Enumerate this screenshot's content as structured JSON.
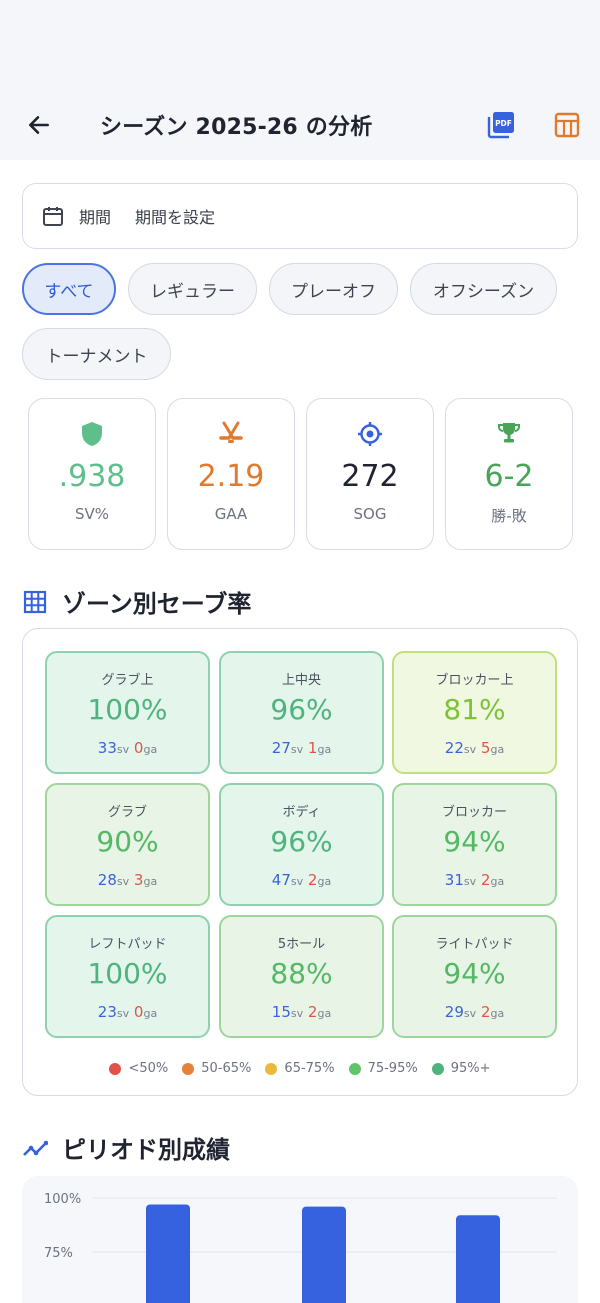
{
  "header": {
    "title": "シーズン 2025-26 の分析",
    "back_icon": "arrow-left-icon",
    "pdf_icon": "pdf-icon",
    "table_icon": "table-icon"
  },
  "period": {
    "label": "期間",
    "value": "期間を設定",
    "icon": "calendar-icon"
  },
  "chips": [
    {
      "label": "すべて",
      "active": true
    },
    {
      "label": "レギュラー",
      "active": false
    },
    {
      "label": "プレーオフ",
      "active": false
    },
    {
      "label": "オフシーズン",
      "active": false
    },
    {
      "label": "トーナメント",
      "active": false
    }
  ],
  "stats": [
    {
      "value": ".938",
      "caption": "SV%",
      "color": "#5fbf8a",
      "icon": "shield-icon"
    },
    {
      "value": "2.19",
      "caption": "GAA",
      "color": "#e07a2f",
      "icon": "crossed-sticks-icon"
    },
    {
      "value": "272",
      "caption": "SOG",
      "color": "#1f2430",
      "icon": "target-icon"
    },
    {
      "value": "6-2",
      "caption": "勝-敗",
      "color": "#4aa457",
      "icon": "trophy-icon"
    }
  ],
  "zones_section": {
    "title": "ゾーン別セーブ率",
    "sv_unit": "sv",
    "ga_unit": "ga",
    "zones": [
      {
        "name": "グラブ上",
        "pct": "100%",
        "sv": "33",
        "ga": "0"
      },
      {
        "name": "上中央",
        "pct": "96%",
        "sv": "27",
        "ga": "1"
      },
      {
        "name": "ブロッカー上",
        "pct": "81%",
        "sv": "22",
        "ga": "5"
      },
      {
        "name": "グラブ",
        "pct": "90%",
        "sv": "28",
        "ga": "3"
      },
      {
        "name": "ボディ",
        "pct": "96%",
        "sv": "47",
        "ga": "2"
      },
      {
        "name": "ブロッカー",
        "pct": "94%",
        "sv": "31",
        "ga": "2"
      },
      {
        "name": "レフトパッド",
        "pct": "100%",
        "sv": "23",
        "ga": "0"
      },
      {
        "name": "5ホール",
        "pct": "88%",
        "sv": "15",
        "ga": "2"
      },
      {
        "name": "ライトパッド",
        "pct": "94%",
        "sv": "29",
        "ga": "2"
      }
    ],
    "legend": [
      {
        "label": "<50%",
        "color": "#e0524a"
      },
      {
        "label": "50-65%",
        "color": "#e5813a"
      },
      {
        "label": "65-75%",
        "color": "#e8b93b"
      },
      {
        "label": "75-95%",
        "color": "#62c46a"
      },
      {
        "label": "95%+",
        "color": "#4fb37e"
      }
    ]
  },
  "period_section": {
    "title": "ピリオド別成績",
    "chart_data": {
      "type": "bar",
      "y_ticks": [
        "100%",
        "75%"
      ],
      "values": [
        0.97,
        0.96,
        0.92
      ],
      "ylim": [
        0.75,
        1.0
      ],
      "color": "#3662e0"
    }
  }
}
